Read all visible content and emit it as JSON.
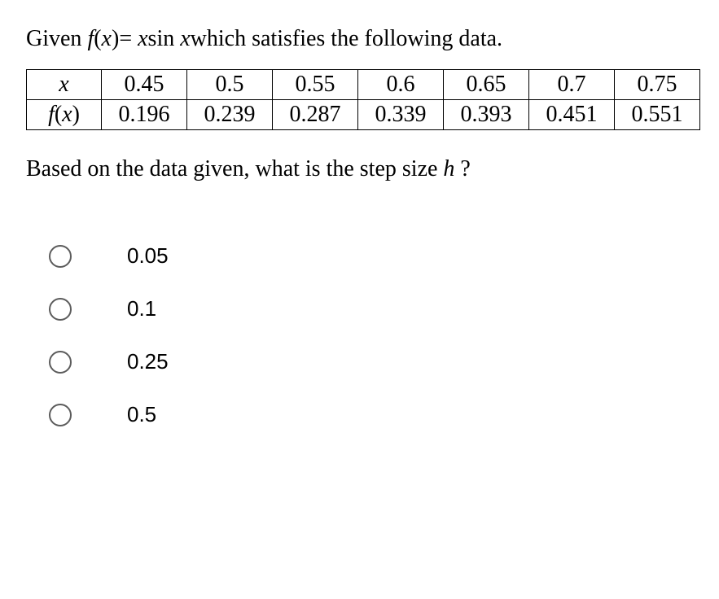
{
  "question": {
    "prefix": "Given ",
    "func_lhs": "f",
    "func_arg_open": "(",
    "func_var1": "x",
    "func_arg_close": ")",
    "eq": "=",
    "rhs_x": "x",
    "rhs_sin": "sin",
    "rhs_x2": "x",
    "suffix": "which satisfies the following data."
  },
  "table": {
    "row1_header": "x",
    "row2_header": "f(x)",
    "x_values": [
      "0.45",
      "0.5",
      "0.55",
      "0.6",
      "0.65",
      "0.7",
      "0.75"
    ],
    "fx_values": [
      "0.196",
      "0.239",
      "0.287",
      "0.339",
      "0.393",
      "0.451",
      "0.551"
    ]
  },
  "prompt": {
    "text1": "Based on the data given, what is the step size ",
    "var": "h",
    "text2": " ?"
  },
  "options": [
    "0.05",
    "0.1",
    "0.25",
    "0.5"
  ],
  "chart_data": {
    "type": "table",
    "title": "f(x) = x sin x",
    "columns": [
      "x",
      "f(x)"
    ],
    "rows": [
      [
        0.45,
        0.196
      ],
      [
        0.5,
        0.239
      ],
      [
        0.55,
        0.287
      ],
      [
        0.6,
        0.339
      ],
      [
        0.65,
        0.393
      ],
      [
        0.7,
        0.451
      ],
      [
        0.75,
        0.551
      ]
    ]
  }
}
